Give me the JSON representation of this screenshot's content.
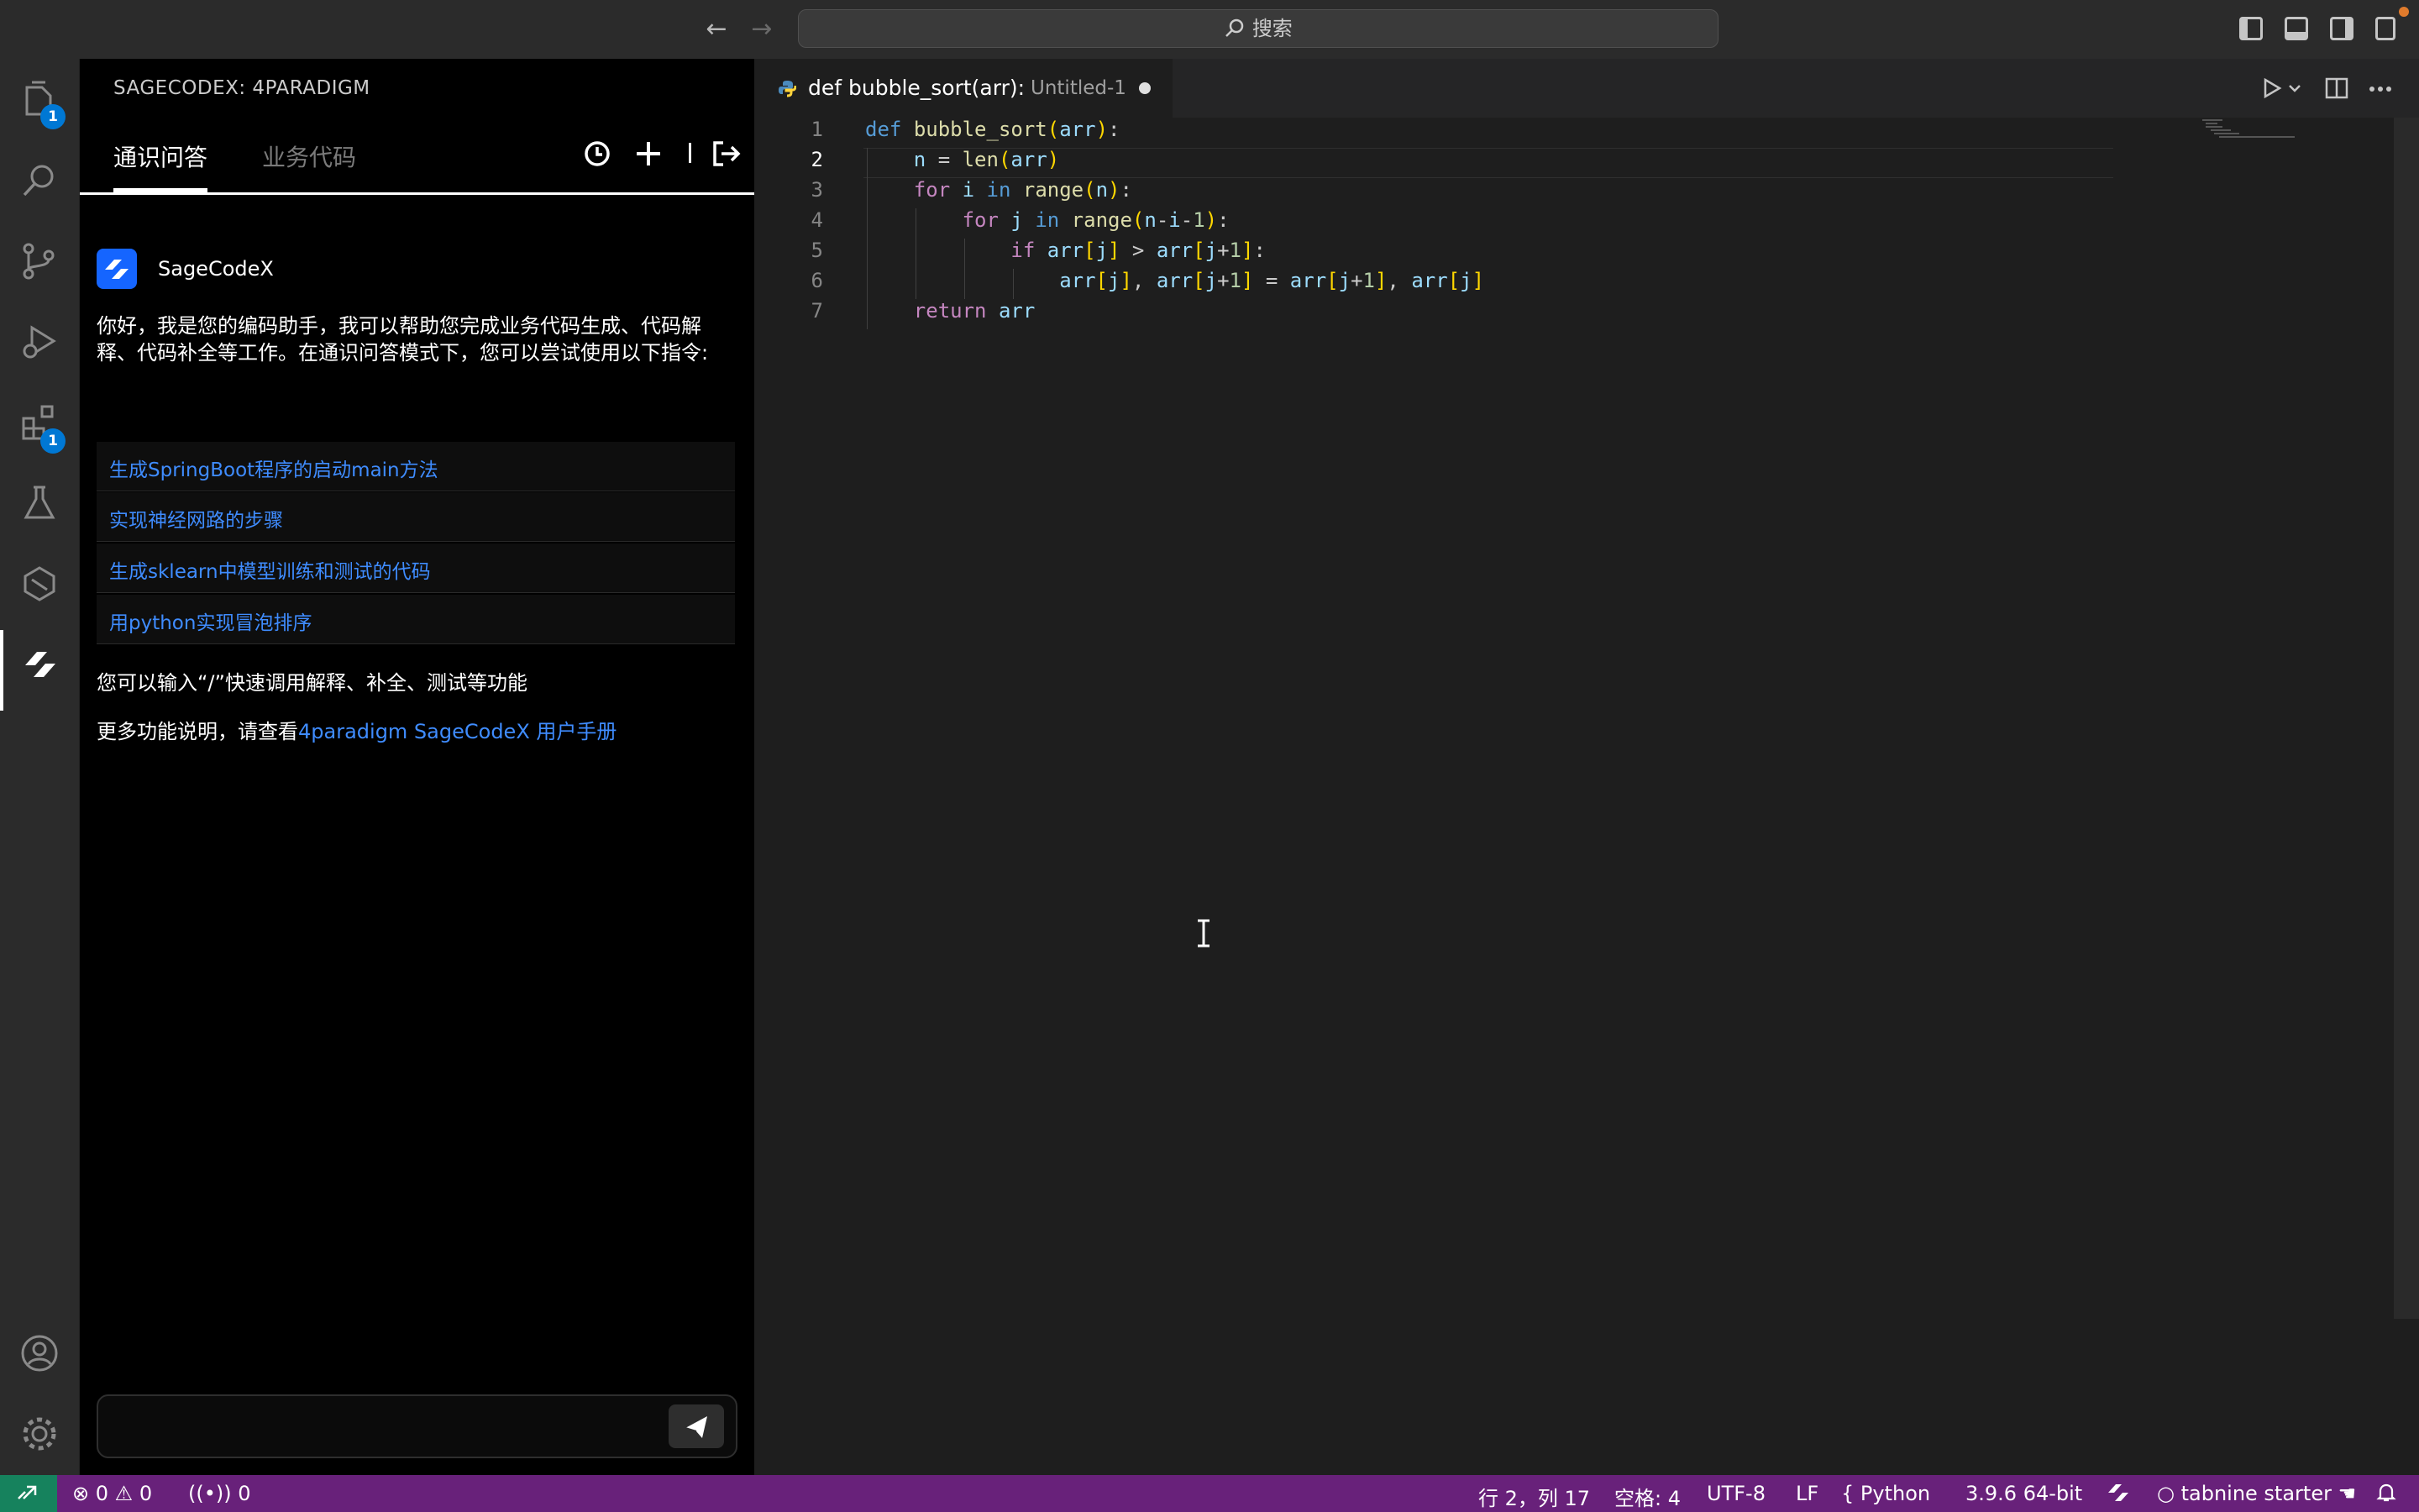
{
  "titlebar": {
    "search_label": "搜索",
    "search_icon": "search-icon",
    "back_icon": "arrow-left-icon",
    "forward_icon": "arrow-right-icon"
  },
  "activity_bar": {
    "explorer_badge": "1",
    "extensions_badge": "1"
  },
  "panel": {
    "title": "SAGECODEX: 4PARADIGM",
    "tabs": [
      {
        "label": "通识问答",
        "active": true
      },
      {
        "label": "业务代码",
        "active": false
      }
    ],
    "bot_name": "SageCodeX",
    "intro": "你好，我是您的编码助手，我可以帮助您完成业务代码生成、代码解释、代码补全等工作。在通识问答模式下，您可以尝试使用以下指令:",
    "suggestions": [
      "生成SpringBoot程序的启动main方法",
      "实现神经网路的步骤",
      "生成sklearn中模型训练和测试的代码",
      "用python实现冒泡排序"
    ],
    "hint": "您可以输入“/”快速调用解释、补全、测试等功能",
    "manual_prefix": "更多功能说明，请查看",
    "manual_link": "4paradigm SageCodeX 用户手册",
    "chat_placeholder": ""
  },
  "editor": {
    "tab_title": "def bubble_sort(arr):",
    "tab_file": "Untitled-1",
    "line_numbers": [
      "1",
      "2",
      "3",
      "4",
      "5",
      "6",
      "7"
    ]
  },
  "statusbar": {
    "errors": "0",
    "warnings": "0",
    "ports": "0",
    "position": "行 2，列 17",
    "spaces": "空格: 4",
    "encoding": "UTF-8",
    "eol": "LF",
    "language": "Python",
    "interpreter": "3.9.6 64-bit",
    "tabnine": "tabnine starter",
    "colors": {
      "statusbar": "#68217a",
      "remote": "#16825d",
      "accent": "#0078d4",
      "link": "#3f8cff"
    }
  }
}
